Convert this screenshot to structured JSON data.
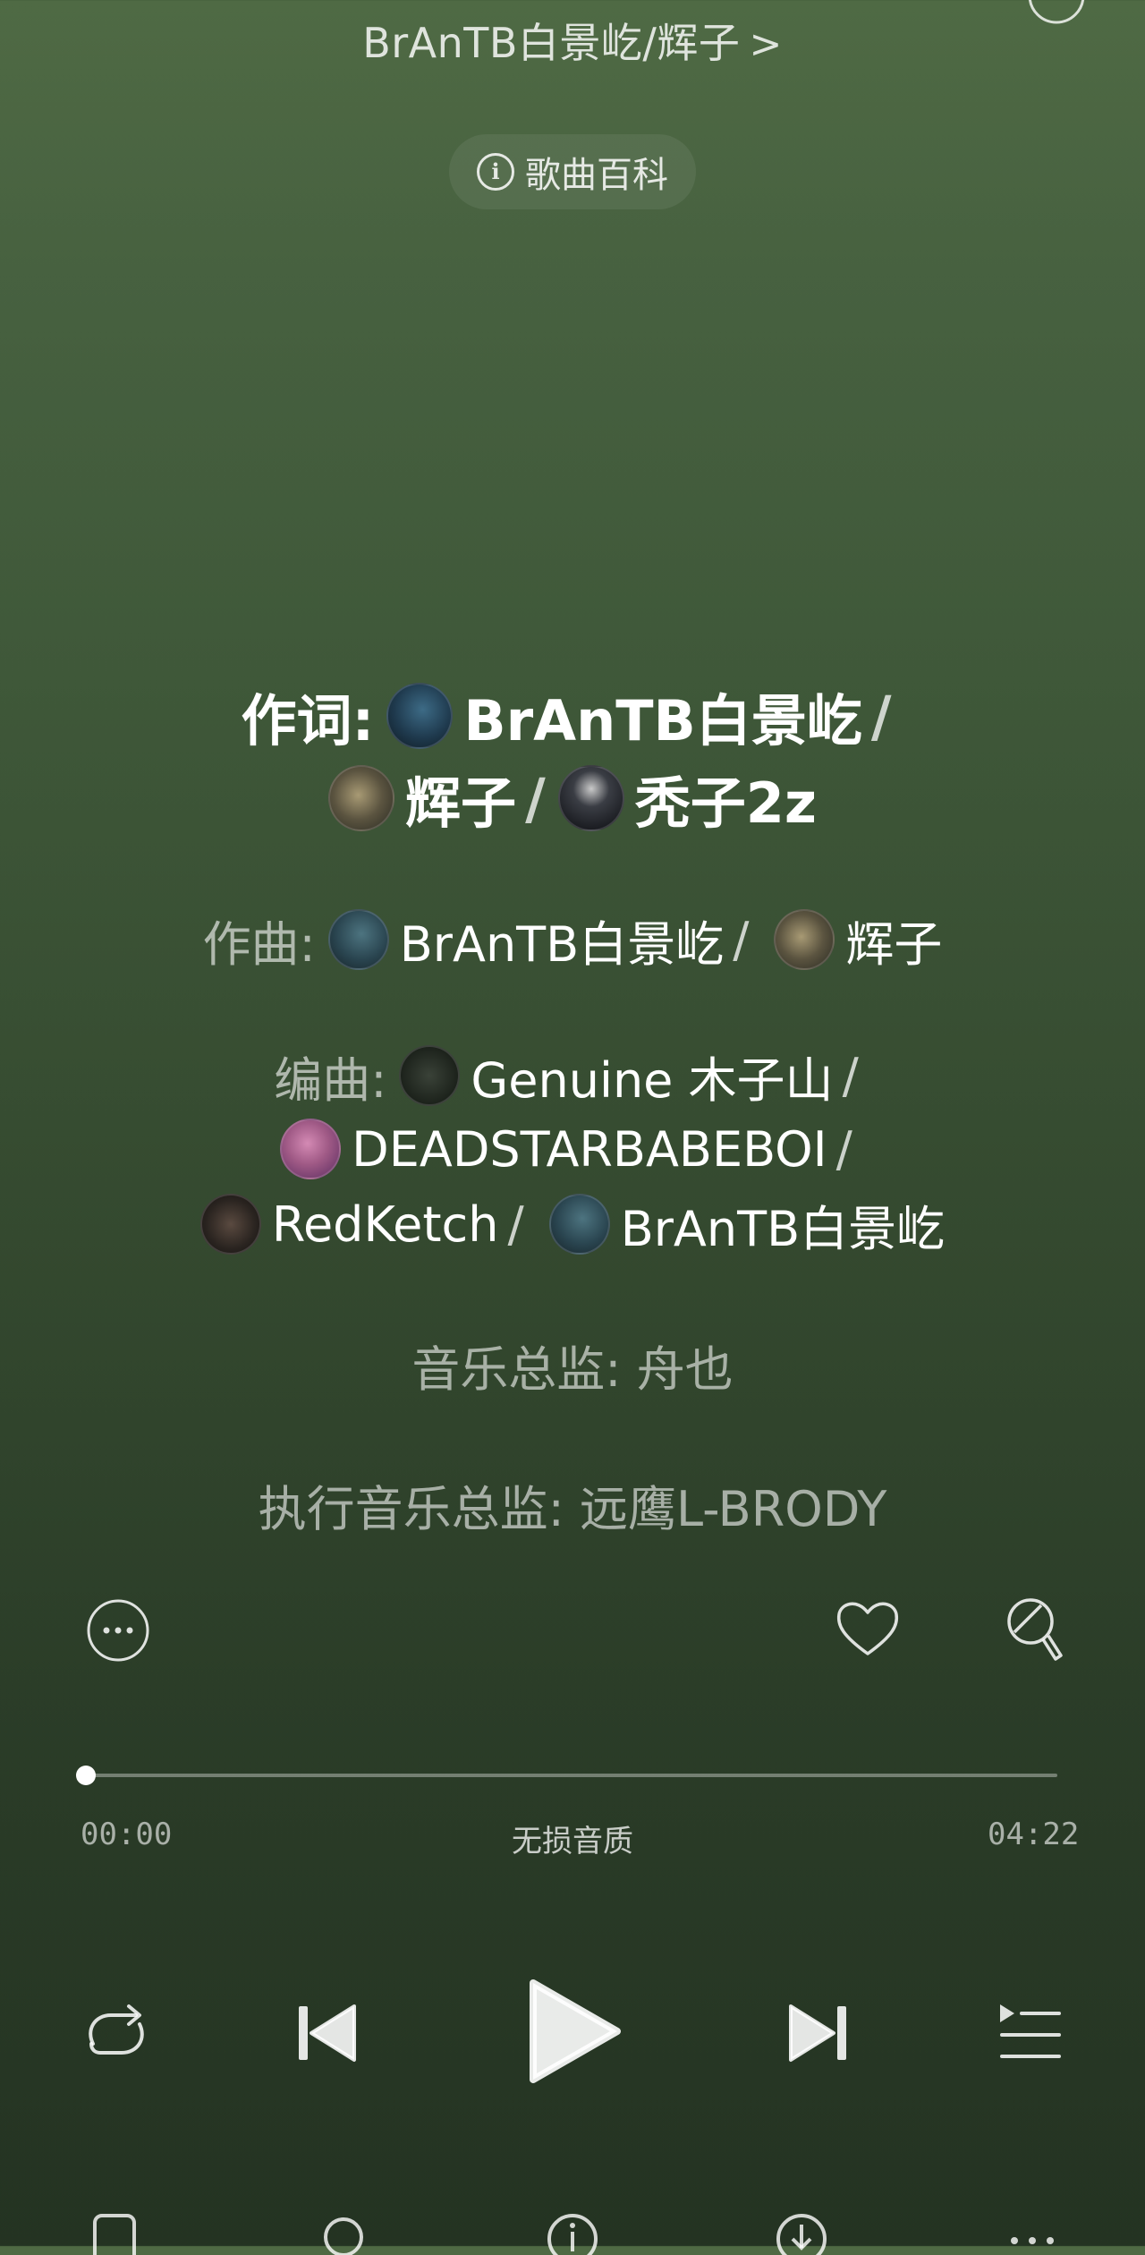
{
  "header": {
    "artists": "BrAnTB白景屹/辉子",
    "chevron": ">"
  },
  "baike": {
    "label": "歌曲百科",
    "icon": "info-icon"
  },
  "credits": {
    "lyrics": {
      "label": "作词:",
      "people": [
        {
          "name": "BrAnTB白景屹",
          "avatar_color": "#1f3a4e"
        },
        {
          "name": "辉子",
          "avatar_color": "#5b5440"
        },
        {
          "name": "秃子2z",
          "avatar_color": "#14161a"
        }
      ]
    },
    "composer": {
      "label": "作曲:",
      "people": [
        {
          "name": "BrAnTB白景屹",
          "avatar_color": "#2a4550"
        },
        {
          "name": "辉子",
          "avatar_color": "#5b5440"
        }
      ]
    },
    "arranger": {
      "label": "编曲:",
      "people": [
        {
          "name": "Genuine 木子山",
          "avatar_color": "#1c221b"
        },
        {
          "name": "DEADSTARBABEBOI",
          "avatar_color": "#a05a86"
        },
        {
          "name": "RedKetch",
          "avatar_color": "#2a2420"
        },
        {
          "name": "BrAnTB白景屹",
          "avatar_color": "#2a4550"
        }
      ]
    },
    "music_director": "音乐总监: 舟也",
    "executive_music_director": "执行音乐总监: 远鹰L-BRODY"
  },
  "actions": {
    "more_icon": "more-circle-icon",
    "like_icon": "heart-icon",
    "sing_icon": "microphone-icon"
  },
  "progress": {
    "current_time": "00:00",
    "total_time": "04:22",
    "quality": "无损音质",
    "fraction": 0.0
  },
  "controls": {
    "repeat_icon": "repeat-icon",
    "prev_icon": "previous-icon",
    "play_icon": "play-icon",
    "next_icon": "next-icon",
    "playlist_icon": "playlist-icon"
  },
  "bottom_bar": [
    "phone-icon",
    "search-icon",
    "info-icon",
    "download-icon",
    "more-icon"
  ],
  "colors": {
    "bg_top": "#4f6a44",
    "bg_bottom": "#243322",
    "text_primary": "#ffffff",
    "text_muted": "#a8b3a4"
  }
}
